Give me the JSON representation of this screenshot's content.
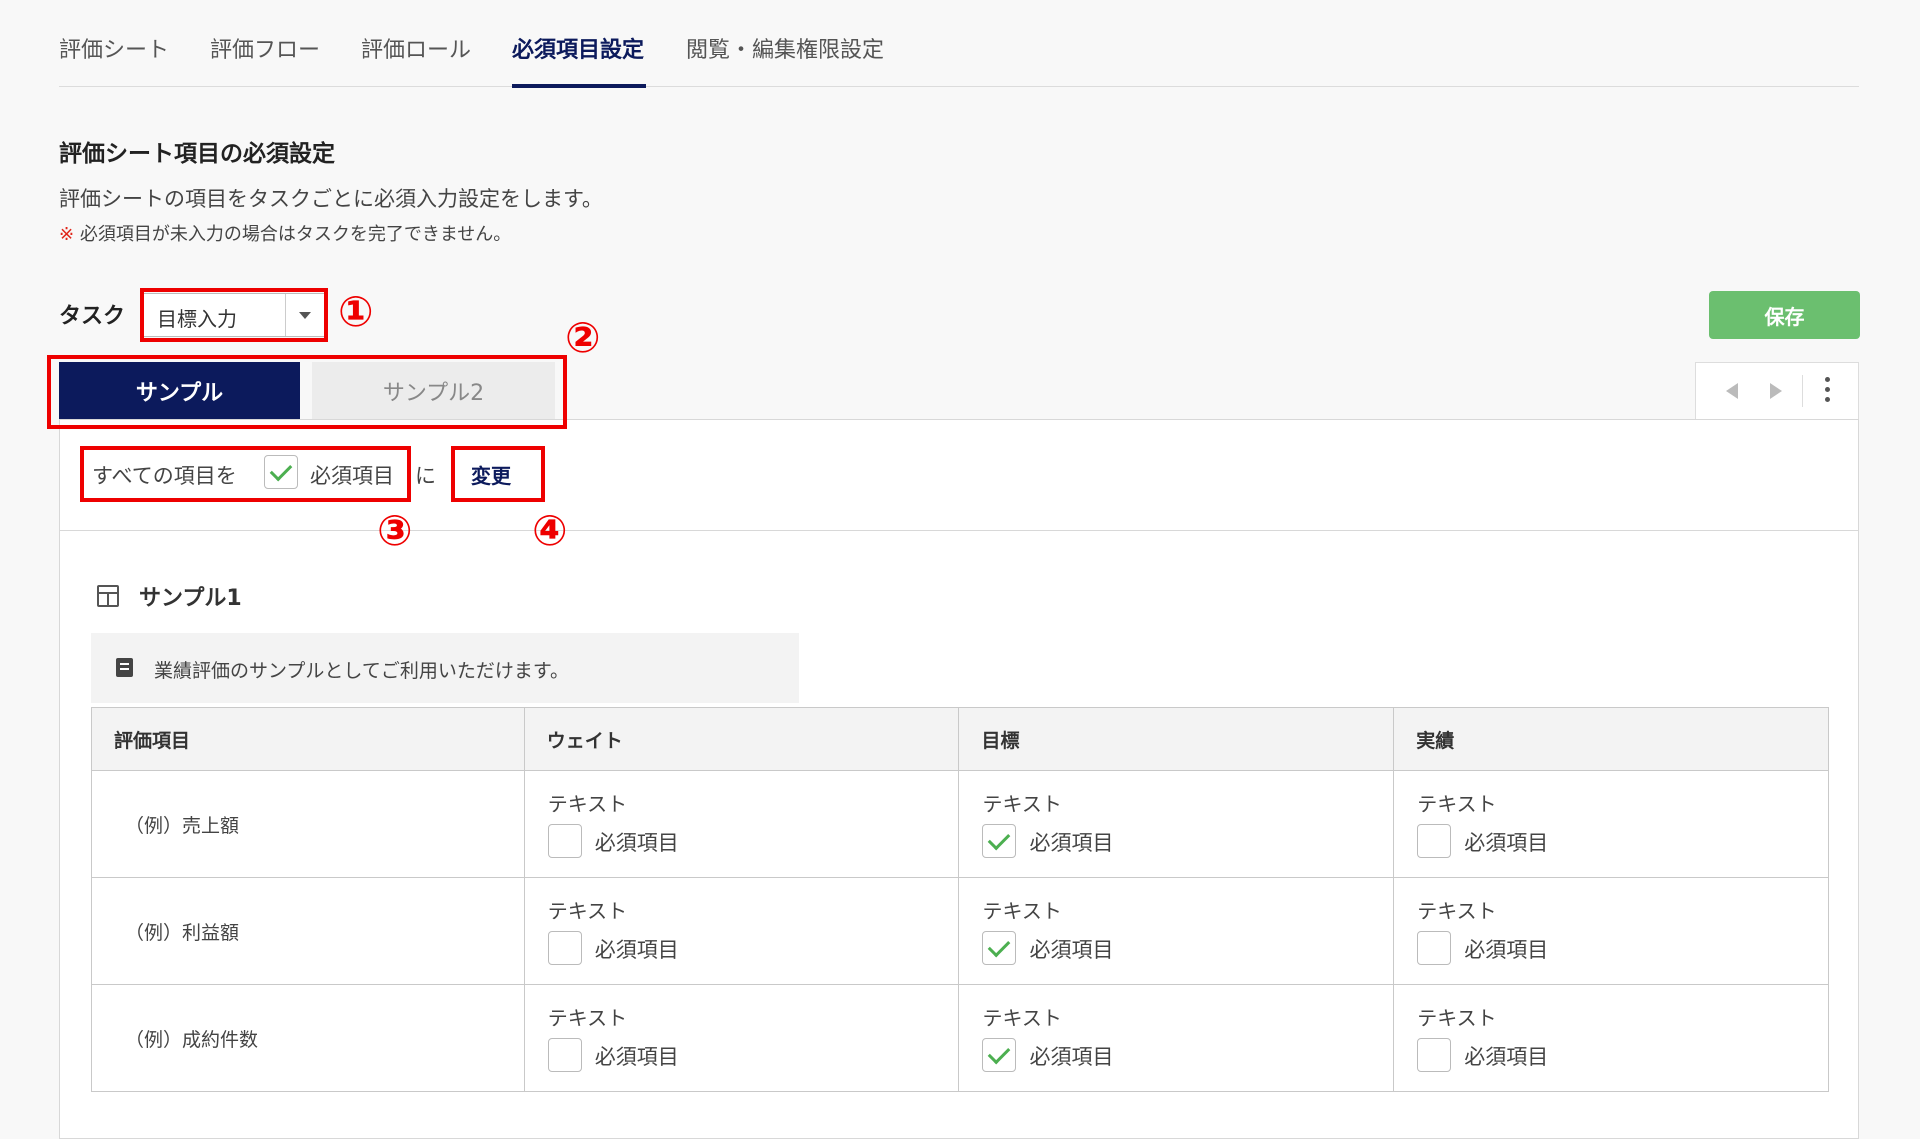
{
  "nav": {
    "tabs": [
      {
        "label": "評価シート"
      },
      {
        "label": "評価フロー"
      },
      {
        "label": "評価ロール"
      },
      {
        "label": "必須項目設定"
      },
      {
        "label": "閲覧・編集権限設定"
      }
    ],
    "active_index": 3
  },
  "section": {
    "title": "評価シート項目の必須設定",
    "description": "評価シートの項目をタスクごとに必須入力設定をします。",
    "note_mark": "※",
    "note": "必須項目が未入力の場合はタスクを完了できません。"
  },
  "task": {
    "label": "タスク",
    "selected": "目標入力"
  },
  "toolbar": {
    "save_label": "保存"
  },
  "sheet_tabs": [
    {
      "label": "サンプル",
      "active": true
    },
    {
      "label": "サンプル2",
      "active": false
    }
  ],
  "bulk": {
    "prefix": "すべての項目を",
    "checkbox_label": "必須項目",
    "checked": true,
    "suffix": "に",
    "change_label": "変更"
  },
  "block": {
    "title": "サンプル1",
    "description": "業績評価のサンプルとしてご利用いただけます。"
  },
  "table": {
    "headers": [
      "評価項目",
      "ウェイト",
      "目標",
      "実績"
    ],
    "rows": [
      {
        "item": "（例）売上額",
        "cells": [
          {
            "type": "テキスト",
            "required_label": "必須項目",
            "checked": false
          },
          {
            "type": "テキスト",
            "required_label": "必須項目",
            "checked": true
          },
          {
            "type": "テキスト",
            "required_label": "必須項目",
            "checked": false
          }
        ]
      },
      {
        "item": "（例）利益額",
        "cells": [
          {
            "type": "テキスト",
            "required_label": "必須項目",
            "checked": false
          },
          {
            "type": "テキスト",
            "required_label": "必須項目",
            "checked": true
          },
          {
            "type": "テキスト",
            "required_label": "必須項目",
            "checked": false
          }
        ]
      },
      {
        "item": "（例）成約件数",
        "cells": [
          {
            "type": "テキスト",
            "required_label": "必須項目",
            "checked": false
          },
          {
            "type": "テキスト",
            "required_label": "必須項目",
            "checked": true
          },
          {
            "type": "テキスト",
            "required_label": "必須項目",
            "checked": false
          }
        ]
      }
    ]
  },
  "annotations": {
    "labels": [
      "①",
      "②",
      "③",
      "④"
    ],
    "color": "#e00000"
  },
  "colors": {
    "primary": "#0c1a5c",
    "save_green": "#6bbf6f",
    "check_green": "#4caf50"
  }
}
